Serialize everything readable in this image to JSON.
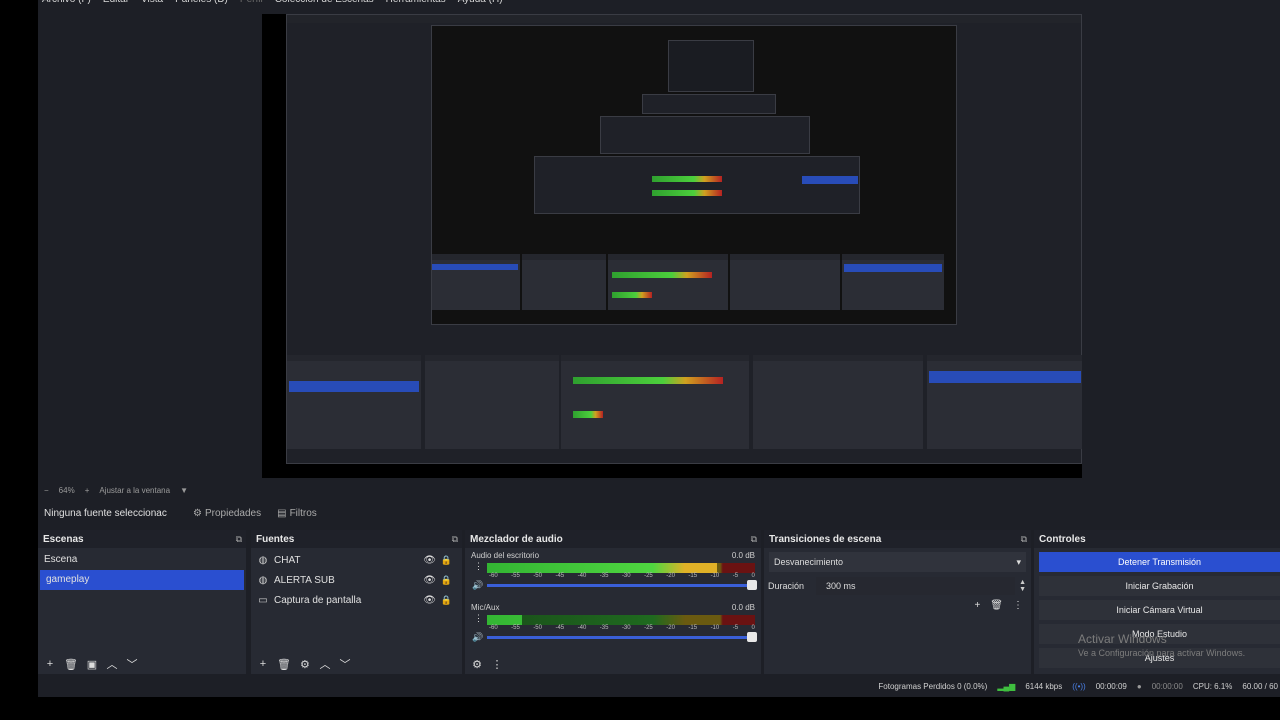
{
  "menu": [
    "Archivo (F)",
    "Editar",
    "Vista",
    "Paneles (D)",
    "Perfil",
    "Colección de Escenas",
    "Herramientas",
    "Ayuda (H)"
  ],
  "zoom": {
    "percent": "64%",
    "fit_label": "Ajustar a la ventana"
  },
  "context": {
    "no_source_label": "Ninguna fuente seleccionac",
    "properties_label": "Propiedades",
    "filters_label": "Filtros"
  },
  "scenes": {
    "title": "Escenas",
    "items": [
      {
        "label": "Escena",
        "selected": false
      },
      {
        "label": "gameplay",
        "selected": true
      }
    ],
    "footer": [
      "+",
      "🗑",
      "▣",
      "︿",
      "﹀"
    ]
  },
  "sources": {
    "title": "Fuentes",
    "items": [
      {
        "label": "CHAT",
        "icon": "globe-icon"
      },
      {
        "label": "ALERTA SUB",
        "icon": "globe-icon"
      },
      {
        "label": "Captura de pantalla",
        "icon": "monitor-icon"
      }
    ],
    "footer": [
      "+",
      "🗑",
      "⚙",
      "︿",
      "﹀"
    ]
  },
  "mixer": {
    "title": "Mezclador de audio",
    "channels": [
      {
        "name": "Audio del escritorio",
        "db": "0.0 dB",
        "level": 0.86
      },
      {
        "name": "Mic/Aux",
        "db": "0.0 dB",
        "level": 0.13
      }
    ],
    "scale": [
      "-60",
      "-55",
      "-50",
      "-45",
      "-40",
      "-35",
      "-30",
      "-25",
      "-20",
      "-15",
      "-10",
      "-5",
      "0"
    ],
    "footer": [
      "⚙",
      "⋮"
    ]
  },
  "transitions": {
    "title": "Transiciones de escena",
    "selected": "Desvanecimiento",
    "duration_label": "Duración",
    "duration_value": "300 ms"
  },
  "controls": {
    "title": "Controles",
    "buttons": [
      "Detener Transmisión",
      "Iniciar Grabación",
      "Iniciar Cámara Virtual",
      "Modo Estudio",
      "Ajustes"
    ]
  },
  "watermark": {
    "line1": "Activar Windows",
    "line2": "Ve a Configuración para activar Windows."
  },
  "status": {
    "dropped": "Fotogramas Perdidos 0 (0.0%)",
    "bitrate": "6144 kbps",
    "live_time": "00:00:09",
    "rec_time": "00:00:00",
    "cpu": "CPU: 6.1%",
    "fps": "60.00 / 60"
  },
  "colors": {
    "accent": "#2a4fd0",
    "panel": "#272a33",
    "background": "#1d1f26"
  }
}
